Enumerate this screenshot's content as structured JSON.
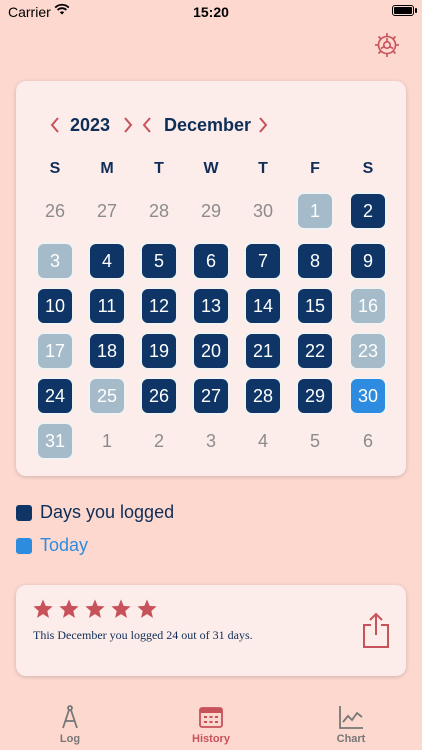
{
  "status": {
    "carrier": "Carrier",
    "time": "15:20"
  },
  "calendar": {
    "year": "2023",
    "month": "December",
    "weekdays": [
      "S",
      "M",
      "T",
      "W",
      "T",
      "F",
      "S"
    ],
    "weeks": [
      [
        {
          "d": "26",
          "s": "out"
        },
        {
          "d": "27",
          "s": "out"
        },
        {
          "d": "28",
          "s": "out"
        },
        {
          "d": "29",
          "s": "out"
        },
        {
          "d": "30",
          "s": "out"
        },
        {
          "d": "1",
          "s": "plain"
        },
        {
          "d": "2",
          "s": "logged"
        }
      ],
      [
        {
          "d": "3",
          "s": "plain"
        },
        {
          "d": "4",
          "s": "logged"
        },
        {
          "d": "5",
          "s": "logged"
        },
        {
          "d": "6",
          "s": "logged"
        },
        {
          "d": "7",
          "s": "logged"
        },
        {
          "d": "8",
          "s": "logged"
        },
        {
          "d": "9",
          "s": "logged"
        }
      ],
      [
        {
          "d": "10",
          "s": "logged"
        },
        {
          "d": "11",
          "s": "logged"
        },
        {
          "d": "12",
          "s": "logged"
        },
        {
          "d": "13",
          "s": "logged"
        },
        {
          "d": "14",
          "s": "logged"
        },
        {
          "d": "15",
          "s": "logged"
        },
        {
          "d": "16",
          "s": "plain"
        }
      ],
      [
        {
          "d": "17",
          "s": "plain"
        },
        {
          "d": "18",
          "s": "logged"
        },
        {
          "d": "19",
          "s": "logged"
        },
        {
          "d": "20",
          "s": "logged"
        },
        {
          "d": "21",
          "s": "logged"
        },
        {
          "d": "22",
          "s": "logged"
        },
        {
          "d": "23",
          "s": "plain"
        }
      ],
      [
        {
          "d": "24",
          "s": "logged"
        },
        {
          "d": "25",
          "s": "plain"
        },
        {
          "d": "26",
          "s": "logged"
        },
        {
          "d": "27",
          "s": "logged"
        },
        {
          "d": "28",
          "s": "logged"
        },
        {
          "d": "29",
          "s": "logged"
        },
        {
          "d": "30",
          "s": "today"
        }
      ],
      [
        {
          "d": "31",
          "s": "plain"
        },
        {
          "d": "1",
          "s": "out"
        },
        {
          "d": "2",
          "s": "out"
        },
        {
          "d": "3",
          "s": "out"
        },
        {
          "d": "4",
          "s": "out"
        },
        {
          "d": "5",
          "s": "out"
        },
        {
          "d": "6",
          "s": "out"
        }
      ]
    ]
  },
  "legend": {
    "logged_label": "Days you logged",
    "today_label": "Today",
    "logged_color": "#0e3566",
    "today_color": "#2e8ce0"
  },
  "summary": {
    "rating": 5,
    "text": "This December you logged 24 out of 31 days."
  },
  "tabs": [
    {
      "label": "Log",
      "icon": "compass-icon"
    },
    {
      "label": "History",
      "icon": "calendar-icon"
    },
    {
      "label": "Chart",
      "icon": "line-chart-icon"
    }
  ],
  "colors": {
    "accent": "#c7525a",
    "background": "#fdd8cf",
    "navy": "#0f2e57"
  }
}
